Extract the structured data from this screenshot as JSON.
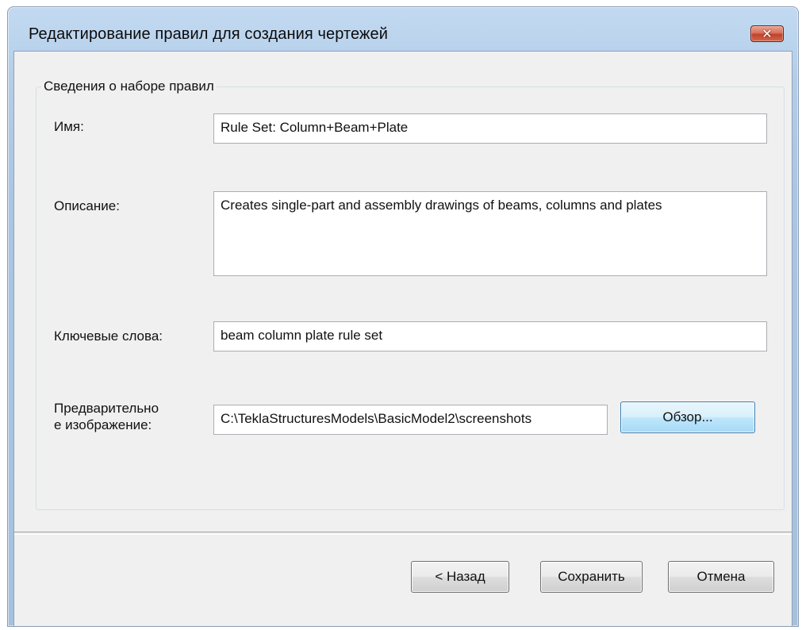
{
  "window": {
    "title": "Редактирование правил для создания чертежей",
    "close_symbol": "✕"
  },
  "group": {
    "legend": "Сведения о наборе правил"
  },
  "fields": {
    "name": {
      "label": "Имя:",
      "value": "Rule Set: Column+Beam+Plate"
    },
    "description": {
      "label": "Описание:",
      "value": "Creates single-part and assembly drawings of beams, columns and plates"
    },
    "keywords": {
      "label": "Ключевые слова:",
      "value": "beam column plate rule set"
    },
    "preview": {
      "label_line1": "Предварительно",
      "label_line2": "е изображение:",
      "value": "C:\\TeklaStructuresModels\\BasicModel2\\screenshots",
      "browse_label": "Обзор..."
    }
  },
  "footer": {
    "back_label": "< Назад",
    "save_label": "Сохранить",
    "cancel_label": "Отмена"
  },
  "icons": {
    "close": "close-icon"
  }
}
